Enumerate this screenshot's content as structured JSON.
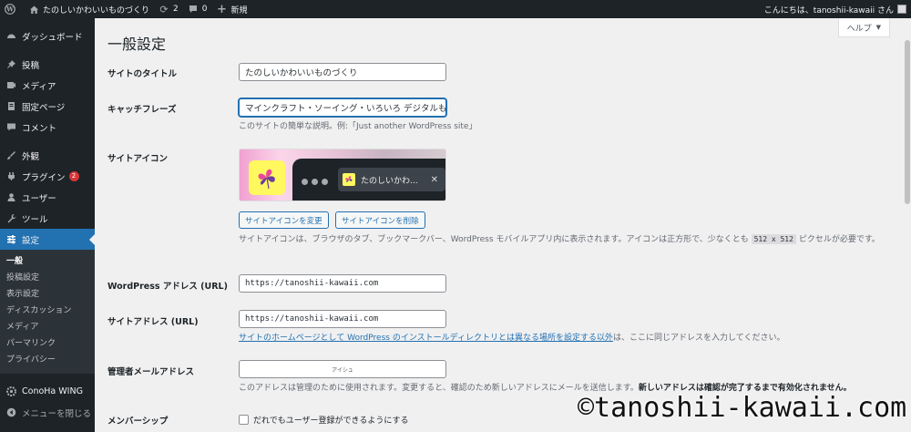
{
  "adminbar": {
    "site_name": "たのしいかわいいものづくり",
    "updates_count": "2",
    "comments_count": "0",
    "new_label": "新規",
    "greeting": "こんにちは、tanoshii-kawaii さん"
  },
  "sidebar": {
    "items": [
      {
        "label": "ダッシュボード",
        "icon": "dashboard-icon"
      },
      {
        "label": "投稿",
        "icon": "pin-icon"
      },
      {
        "label": "メディア",
        "icon": "media-icon"
      },
      {
        "label": "固定ページ",
        "icon": "page-icon"
      },
      {
        "label": "コメント",
        "icon": "comment-icon"
      },
      {
        "label": "外観",
        "icon": "brush-icon"
      },
      {
        "label": "プラグイン",
        "icon": "plugin-icon",
        "badge": "2"
      },
      {
        "label": "ユーザー",
        "icon": "user-icon"
      },
      {
        "label": "ツール",
        "icon": "wrench-icon"
      },
      {
        "label": "設定",
        "icon": "settings-icon"
      }
    ],
    "submenu": [
      "一般",
      "投稿設定",
      "表示設定",
      "ディスカッション",
      "メディア",
      "パーマリンク",
      "プライバシー"
    ],
    "conoha_label": "ConoHa WING",
    "collapse_label": "メニューを閉じる"
  },
  "main": {
    "title": "一般設定",
    "help_label": "ヘルプ",
    "site_title_label": "サイトのタイトル",
    "site_title_value": "たのしいかわいいものづくり",
    "tagline_label": "キャッチフレーズ",
    "tagline_value": "マインクラフト・ソーイング・いろいろ デジタルもの",
    "tagline_desc": "このサイトの簡単な説明。例:「Just another WordPress site」",
    "site_icon_label": "サイトアイコン",
    "preview_tab_title": "たのしいかわ...",
    "change_icon_button": "サイトアイコンを変更",
    "remove_icon_button": "サイトアイコンを削除",
    "icon_desc_before": "サイトアイコンは、ブラウザのタブ、ブックマークバー、WordPress モバイルアプリ内に表示されます。アイコンは正方形で、少なくとも",
    "icon_desc_code": "512 x 512",
    "icon_desc_after": "ピクセルが必要です。",
    "wp_address_label": "WordPress アドレス (URL)",
    "wp_address_value": "https://tanoshii-kawaii.com",
    "site_address_label": "サイトアドレス (URL)",
    "site_address_value": "https://tanoshii-kawaii.com",
    "site_address_link": "サイトのホームページとして WordPress のインストールディレクトリとは異なる場所を設定する以外",
    "site_address_desc_after": "は、ここに同じアドレスを入力してください。",
    "admin_email_label": "管理者メールアドレス",
    "admin_email_value": "アイシュ",
    "admin_email_desc": "このアドレスは管理のために使用されます。変更すると、確認のため新しいアドレスにメールを送信します。",
    "admin_email_desc_bold": "新しいアドレスは確認が完了するまで有効化されません。",
    "membership_label": "メンバーシップ",
    "membership_checkbox_label": "だれでもユーザー登録ができるようにする"
  },
  "watermark": "©tanoshii-kawaii.com",
  "colors": {
    "adminbar_bg": "#1d2327",
    "accent": "#2271b1",
    "badge": "#d63638",
    "icon_bg": "#fff85f"
  }
}
